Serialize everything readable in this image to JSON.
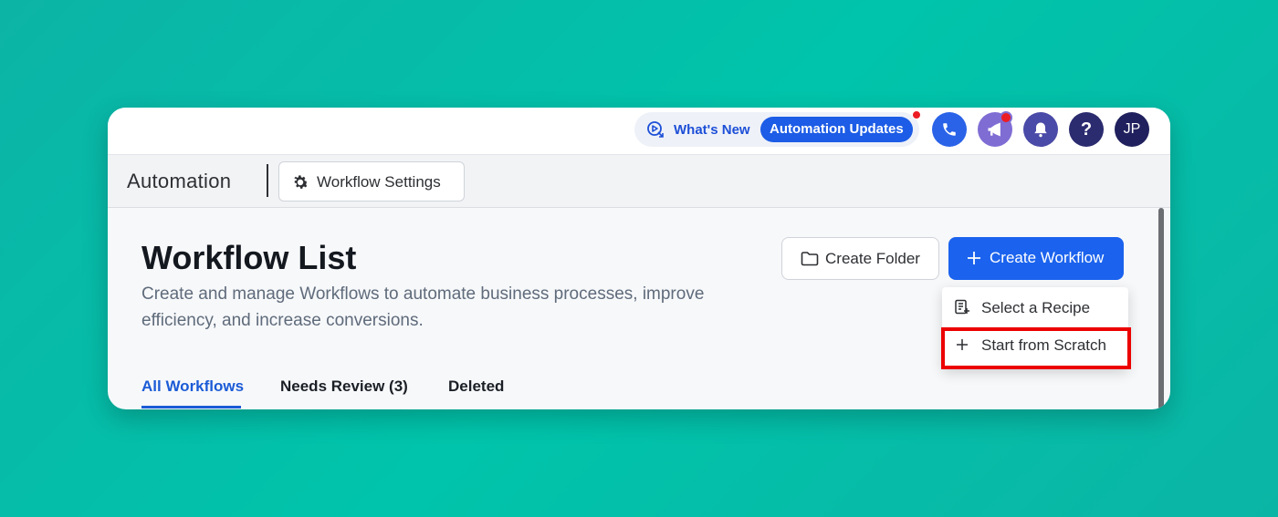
{
  "header": {
    "whats_new_label": "What's New",
    "updates_pill": "Automation Updates",
    "help_label": "?",
    "avatar_initials": "JP"
  },
  "subbar": {
    "app_title": "Automation",
    "settings_label": "Workflow Settings"
  },
  "main": {
    "title": "Workflow List",
    "description": "Create and manage Workflows to automate business processes, improve efficiency, and increase conversions.",
    "create_folder_label": "Create Folder",
    "create_workflow_label": "Create Workflow",
    "tabs": [
      {
        "label": "All Workflows",
        "active": true
      },
      {
        "label": "Needs Review (3)",
        "active": false
      },
      {
        "label": "Deleted",
        "active": false
      }
    ]
  },
  "dropdown": {
    "items": [
      {
        "label": "Select a Recipe",
        "icon": "recipe-icon"
      },
      {
        "label": "Start from Scratch",
        "icon": "plus-icon",
        "highlighted": true
      }
    ]
  },
  "colors": {
    "accent": "#1b63ee",
    "highlight": "#ec0000",
    "background": "#00c4ab"
  }
}
